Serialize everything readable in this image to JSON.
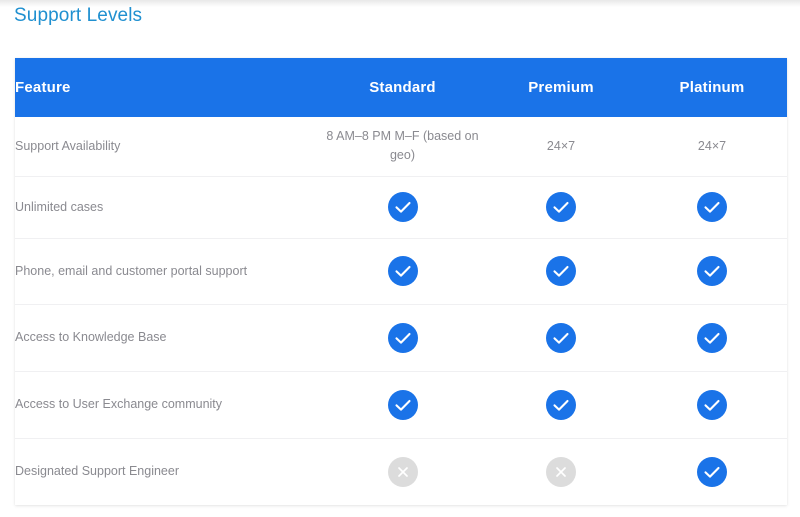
{
  "page": {
    "title": "Support Levels",
    "title_color": "#2090d0",
    "header_color": "#1a73e8",
    "yes_color": "#1a73e8",
    "no_color": "#dcdcdc"
  },
  "table": {
    "columns": [
      {
        "key": "feature",
        "label": "Feature"
      },
      {
        "key": "standard",
        "label": "Standard"
      },
      {
        "key": "premium",
        "label": "Premium"
      },
      {
        "key": "platinum",
        "label": "Platinum"
      }
    ],
    "rows": [
      {
        "feature": "Support Availability",
        "standard": {
          "type": "text",
          "value": "8 AM–8 PM M–F (based on geo)"
        },
        "premium": {
          "type": "text",
          "value": "24×7"
        },
        "platinum": {
          "type": "text",
          "value": "24×7"
        }
      },
      {
        "feature": "Unlimited cases",
        "standard": {
          "type": "check",
          "icon": "check-circle-icon"
        },
        "premium": {
          "type": "check",
          "icon": "check-circle-icon"
        },
        "platinum": {
          "type": "check",
          "icon": "check-circle-icon"
        }
      },
      {
        "feature": "Phone, email and customer portal support",
        "standard": {
          "type": "check",
          "icon": "check-circle-icon"
        },
        "premium": {
          "type": "check",
          "icon": "check-circle-icon"
        },
        "platinum": {
          "type": "check",
          "icon": "check-circle-icon"
        }
      },
      {
        "feature": "Access to Knowledge Base",
        "standard": {
          "type": "check",
          "icon": "check-circle-icon"
        },
        "premium": {
          "type": "check",
          "icon": "check-circle-icon"
        },
        "platinum": {
          "type": "check",
          "icon": "check-circle-icon"
        }
      },
      {
        "feature": "Access to User Exchange community",
        "standard": {
          "type": "check",
          "icon": "check-circle-icon"
        },
        "premium": {
          "type": "check",
          "icon": "check-circle-icon"
        },
        "platinum": {
          "type": "check",
          "icon": "check-circle-icon"
        }
      },
      {
        "feature": "Designated Support Engineer",
        "standard": {
          "type": "cross",
          "icon": "cross-circle-icon"
        },
        "premium": {
          "type": "cross",
          "icon": "cross-circle-icon"
        },
        "platinum": {
          "type": "check",
          "icon": "check-circle-icon"
        }
      }
    ]
  }
}
